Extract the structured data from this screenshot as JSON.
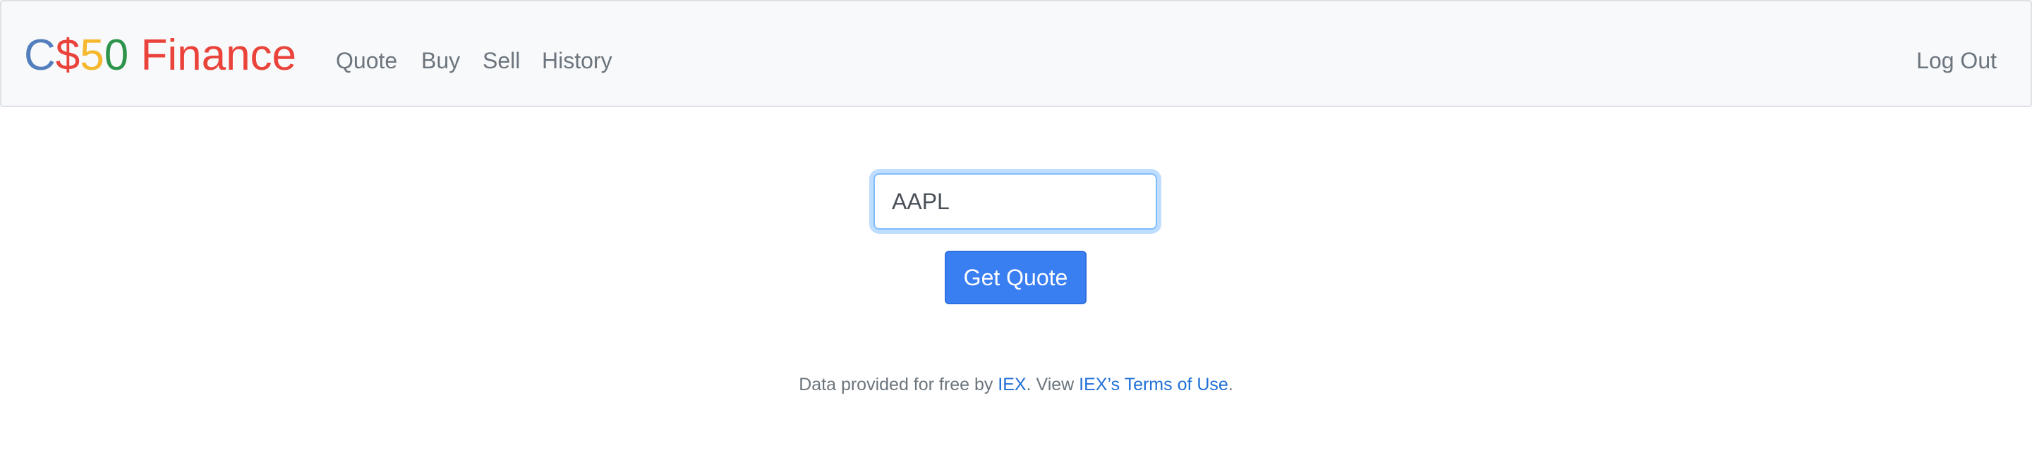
{
  "brand": {
    "parts": [
      {
        "text": "C",
        "color": "#537fbe"
      },
      {
        "text": "$",
        "color": "#ea433b"
      },
      {
        "text": "5",
        "color": "#f5b82e"
      },
      {
        "text": "0",
        "color": "#2e944b"
      },
      {
        "text": " Finance",
        "color": "#ea433b"
      }
    ]
  },
  "nav": {
    "items": [
      {
        "label": "Quote"
      },
      {
        "label": "Buy"
      },
      {
        "label": "Sell"
      },
      {
        "label": "History"
      }
    ],
    "logout_label": "Log Out"
  },
  "form": {
    "symbol_value": "AAPL",
    "submit_label": "Get Quote"
  },
  "footer": {
    "prefix": "Data provided for free by ",
    "iex_link": "IEX",
    "middle": ". View ",
    "terms_link": "IEX’s Terms of Use",
    "suffix": "."
  },
  "colors": {
    "nav_background": "#f8f9fa",
    "link_color": "#1f6fd6",
    "button_color": "#3a7ff2"
  }
}
